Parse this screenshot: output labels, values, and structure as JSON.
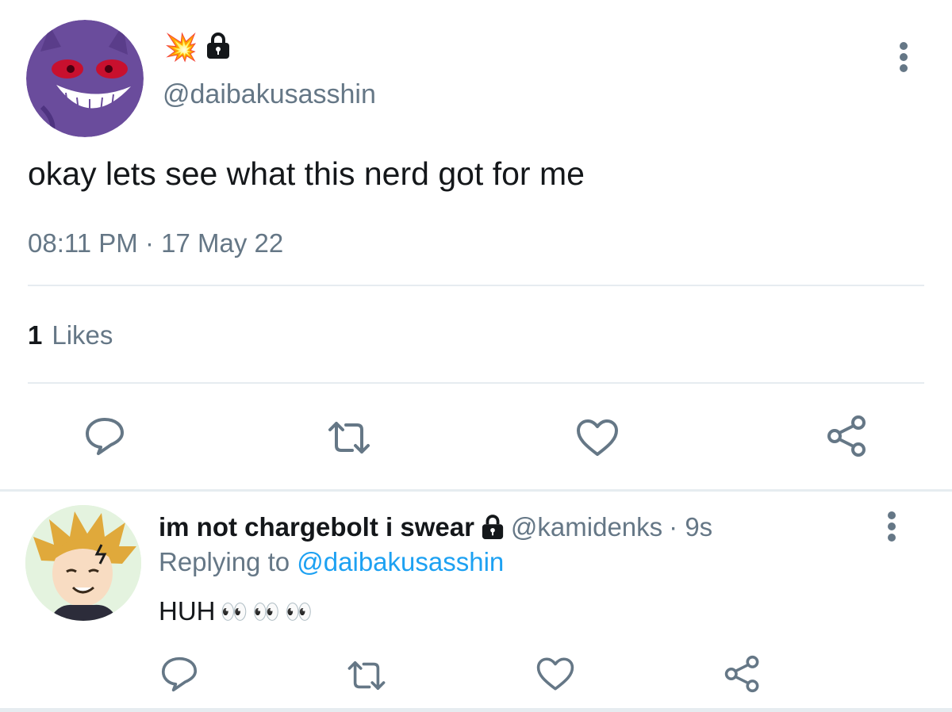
{
  "tweet": {
    "badge_emoji": "💥",
    "lock_icon": "lock-icon",
    "handle": "@daibakusasshin",
    "text": "okay lets see what this nerd got for me",
    "timestamp": "08:11 PM · 17 May 22",
    "likes_count": "1",
    "likes_label": "Likes",
    "actions": [
      "reply-icon",
      "retweet-icon",
      "heart-icon",
      "share-icon"
    ]
  },
  "reply": {
    "display_name": "im not chargebolt i swear",
    "handle": "@kamidenks",
    "time": "· 9s",
    "replying_prefix": "Replying to",
    "replying_to": "@daibakusasshin",
    "text": "HUH",
    "eyes_emoji": [
      "👀",
      "👀",
      "👀"
    ],
    "actions": [
      "reply-icon",
      "retweet-icon",
      "heart-icon",
      "share-icon"
    ]
  },
  "colors": {
    "text": "#14171a",
    "secondary": "#657786",
    "link": "#1da1f2",
    "divider": "#e6ecf0",
    "icon": "#657786"
  }
}
